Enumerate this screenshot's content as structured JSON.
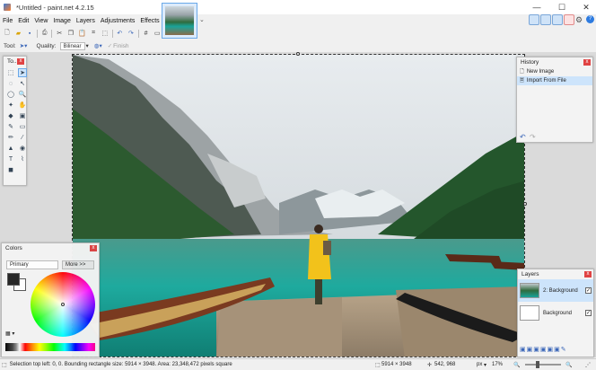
{
  "window": {
    "title": "*Untitled - paint.net 4.2.15",
    "minimize_glyph": "—",
    "maximize_glyph": "☐",
    "close_glyph": "✕"
  },
  "menu": [
    "File",
    "Edit",
    "View",
    "Image",
    "Layers",
    "Adjustments",
    "Effects"
  ],
  "toolbar": {
    "tool_label": "Tool:",
    "quality_label": "Quality:",
    "quality_value": "Bilinear",
    "finish_label": "Finish"
  },
  "tools_panel": {
    "title": "To..."
  },
  "history_panel": {
    "title": "History",
    "items": [
      {
        "label": "New Image",
        "icon": "new-image-icon"
      },
      {
        "label": "Import From File",
        "icon": "import-icon"
      }
    ]
  },
  "colors_panel": {
    "title": "Colors",
    "mode_value": "Primary",
    "more_label": "More >>",
    "primary_color": "#222222",
    "secondary_color": "#ffffff"
  },
  "layers_panel": {
    "title": "Layers",
    "layers": [
      {
        "name": "2: Background",
        "visible": true
      },
      {
        "name": "Background",
        "visible": true
      }
    ]
  },
  "status": {
    "selection_info": "Selection top left: 0, 0. Bounding rectangle size: 5914 × 3948. Area: 23,348,472 pixels square",
    "image_size": "5914 × 3948",
    "cursor_pos": "542, 968",
    "units": "px",
    "zoom": "17%"
  },
  "colors": {
    "accent": "#6aa8e8",
    "close_red": "#e04343",
    "selection_blue": "#cde4fb"
  }
}
